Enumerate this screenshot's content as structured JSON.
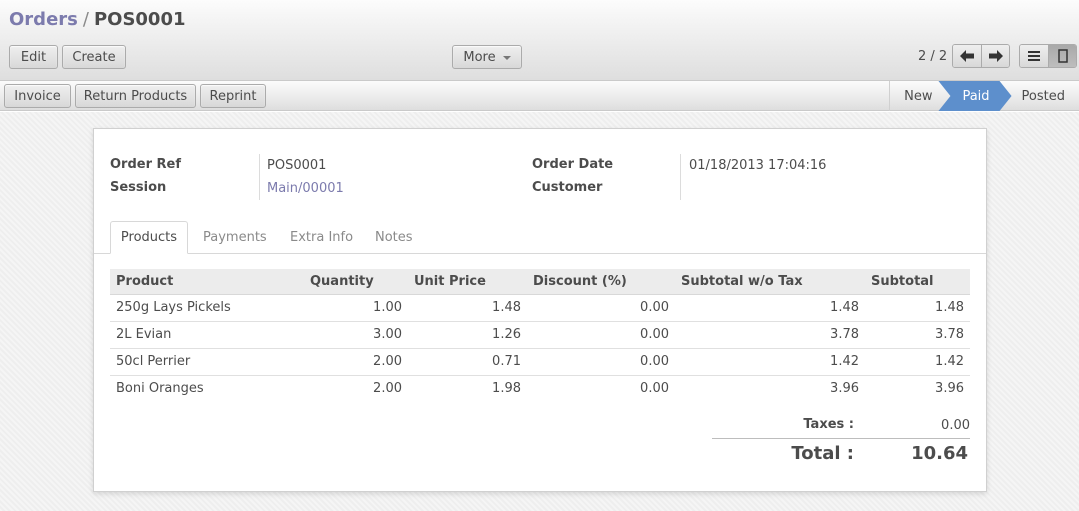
{
  "breadcrumb": {
    "parent": "Orders",
    "separator": "/",
    "current": "POS0001"
  },
  "toolbar": {
    "edit": "Edit",
    "create": "Create",
    "more": "More"
  },
  "pager": {
    "text": "2 / 2"
  },
  "actions": {
    "invoice": "Invoice",
    "return_products": "Return Products",
    "reprint": "Reprint"
  },
  "stages": {
    "new": "New",
    "paid": "Paid",
    "posted": "Posted",
    "active": "Paid",
    "active_color": "#5d8fcc"
  },
  "form": {
    "order_ref_label": "Order Ref",
    "order_ref": "POS0001",
    "session_label": "Session",
    "session": "Main/00001",
    "order_date_label": "Order Date",
    "order_date": "01/18/2013 17:04:16",
    "customer_label": "Customer",
    "customer": ""
  },
  "tabs": [
    "Products",
    "Payments",
    "Extra Info",
    "Notes"
  ],
  "lines": {
    "columns": [
      "Product",
      "Quantity",
      "Unit Price",
      "Discount (%)",
      "Subtotal w/o Tax",
      "Subtotal"
    ],
    "rows": [
      [
        "250g Lays Pickels",
        "1.00",
        "1.48",
        "0.00",
        "1.48",
        "1.48"
      ],
      [
        "2L Evian",
        "3.00",
        "1.26",
        "0.00",
        "3.78",
        "3.78"
      ],
      [
        "50cl Perrier",
        "2.00",
        "0.71",
        "0.00",
        "1.42",
        "1.42"
      ],
      [
        "Boni Oranges",
        "2.00",
        "1.98",
        "0.00",
        "3.96",
        "3.96"
      ]
    ]
  },
  "totals": {
    "taxes_label": "Taxes :",
    "taxes": "0.00",
    "total_label": "Total :",
    "total": "10.64"
  },
  "colors": {
    "link": "#7c7bad",
    "accent": "#5d8fcc"
  }
}
